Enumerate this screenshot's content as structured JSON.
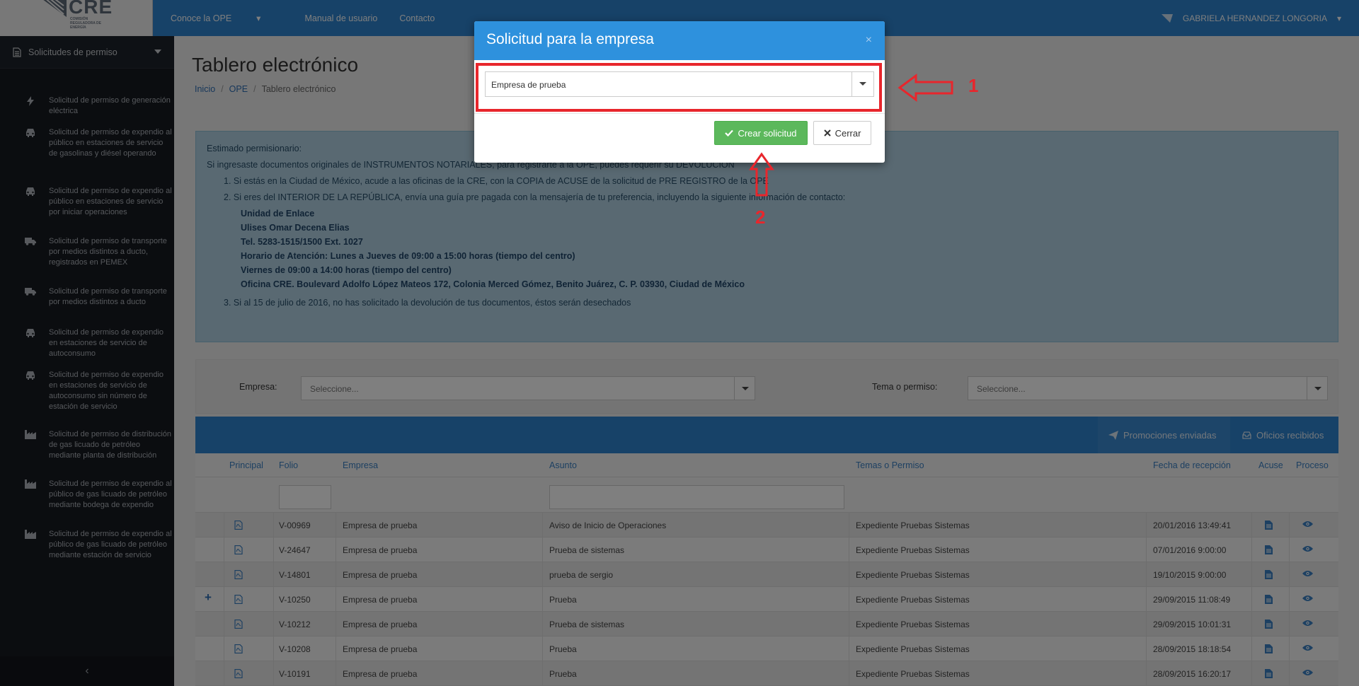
{
  "topbar": {
    "logo_text": "CRE",
    "logo_subtitle": "COMISIÓN REGULADORA DE ENERGÍA",
    "nav": [
      "Conoce la OPE",
      "Manual de usuario",
      "Contacto"
    ],
    "user_name": "GABRIELA HERNANDEZ LONGORIA"
  },
  "sidebar": {
    "header": "Solicitudes de permiso",
    "items": [
      {
        "icon": "bolt-icon",
        "label": "Solicitud de permiso de generación eléctrica"
      },
      {
        "icon": "car-icon",
        "label": "Solicitud de permiso de expendio al público en estaciones de servicio de gasolinas y diésel operando"
      },
      {
        "icon": "car-icon",
        "label": "Solicitud de permiso de expendio al público en estaciones de servicio por iniciar operaciones"
      },
      {
        "icon": "truck-icon",
        "label": "Solicitud de permiso de transporte por medios distintos a ducto, registrados en PEMEX"
      },
      {
        "icon": "truck-icon",
        "label": "Solicitud de permiso de transporte por medios distintos a ducto"
      },
      {
        "icon": "car-icon",
        "label": "Solicitud de permiso de expendio en estaciones de servicio de autoconsumo"
      },
      {
        "icon": "car-icon",
        "label": "Solicitud de permiso de expendio en estaciones de servicio de autoconsumo sin número de estación de servicio"
      },
      {
        "icon": "industry-icon",
        "label": "Solicitud de permiso de distribución de gas licuado de petróleo mediante planta de distribución"
      },
      {
        "icon": "industry-icon",
        "label": "Solicitud de permiso de expendio al público de gas licuado de petróleo mediante bodega de expendio"
      },
      {
        "icon": "industry-icon",
        "label": "Solicitud de permiso de expendio al público de gas licuado de petróleo mediante estación de servicio"
      }
    ],
    "collapse_label": "‹"
  },
  "main": {
    "title": "Tablero electrónico",
    "breadcrumb": [
      "Inicio",
      "OPE",
      "Tablero electrónico"
    ],
    "info": {
      "greeting": "Estimado permisionario:",
      "intro": "Si ingresaste documentos originales de INSTRUMENTOS NOTARIALES, para registrarte a la OPE, puedes requerir su DEVOLUCIÓN",
      "item1": "1. Si estás en la Ciudad de México, acude a las oficinas de la CRE, con la COPIA de ACUSE de la solicitud de PRE REGISTRO de la OPE",
      "item2": "2. Si eres del INTERIOR DE LA REPÚBLICA, envía una guía pre pagada con la mensajería de tu preferencia, incluyendo la siguiente información de contacto:",
      "contact": [
        "Unidad de Enlace",
        "Ulises Omar Decena Elias",
        "Tel. 5283-1515/1500 Ext. 1027",
        "Horario de Atención: Lunes a Jueves de 09:00 a 15:00 horas (tiempo del centro)",
        "Viernes de 09:00 a 14:00 horas (tiempo del centro)",
        "Oficina CRE. Boulevard Adolfo López Mateos 172, Colonia Merced Gómez, Benito Juárez, C. P. 03930, Ciudad de México"
      ],
      "item3": "3. Si al 15 de julio de 2016, no has solicitado la devolución de tus documentos, éstos serán desechados"
    },
    "filters": {
      "empresa_label": "Empresa:",
      "empresa_placeholder": "Seleccione...",
      "tema_label": "Tema o permiso:",
      "tema_placeholder": "Seleccione..."
    },
    "table": {
      "tabs": [
        "Promociones enviadas",
        "Oficios recibidos"
      ],
      "columns": [
        "Principal",
        "Folio",
        "Empresa",
        "Asunto",
        "Temas o Permiso",
        "Fecha de recepción",
        "Acuse",
        "Proceso"
      ],
      "rows": [
        {
          "expand": "",
          "folio": "V-00969",
          "empresa": "Empresa de prueba",
          "asunto": "Aviso de Inicio de Operaciones",
          "tema": "Expediente Pruebas Sistemas",
          "fecha": "20/01/2016 13:49:41"
        },
        {
          "expand": "",
          "folio": "V-24647",
          "empresa": "Empresa de prueba",
          "asunto": "Prueba de sistemas",
          "tema": "Expediente Pruebas Sistemas",
          "fecha": "07/01/2016 9:00:00"
        },
        {
          "expand": "",
          "folio": "V-14801",
          "empresa": "Empresa de prueba",
          "asunto": "prueba de sergio",
          "tema": "Expediente Pruebas Sistemas",
          "fecha": "19/10/2015 9:00:00"
        },
        {
          "expand": "+",
          "folio": "V-10250",
          "empresa": "Empresa de prueba",
          "asunto": "Prueba",
          "tema": "Expediente Pruebas Sistemas",
          "fecha": "29/09/2015 11:08:49"
        },
        {
          "expand": "",
          "folio": "V-10212",
          "empresa": "Empresa de prueba",
          "asunto": "Prueba de sistemas",
          "tema": "Expediente Pruebas Sistemas",
          "fecha": "29/09/2015 10:01:31"
        },
        {
          "expand": "",
          "folio": "V-10208",
          "empresa": "Empresa de prueba",
          "asunto": "Prueba",
          "tema": "Expediente Pruebas Sistemas",
          "fecha": "28/09/2015 18:18:54"
        },
        {
          "expand": "",
          "folio": "V-10191",
          "empresa": "Empresa de prueba",
          "asunto": "Prueba",
          "tema": "Expediente Pruebas Sistemas",
          "fecha": "28/09/2015 16:20:17"
        }
      ]
    }
  },
  "modal": {
    "title": "Solicitud para la empresa",
    "close_glyph": "×",
    "select_value": "Empresa de prueba",
    "create_label": "Crear solicitud",
    "cancel_label": "Cerrar"
  },
  "annotations": {
    "label_1": "1",
    "label_2": "2",
    "color": "#e8262c"
  },
  "colors": {
    "primary": "#2e85d0",
    "success": "#5cb85c",
    "sidebar": "#161a20"
  }
}
